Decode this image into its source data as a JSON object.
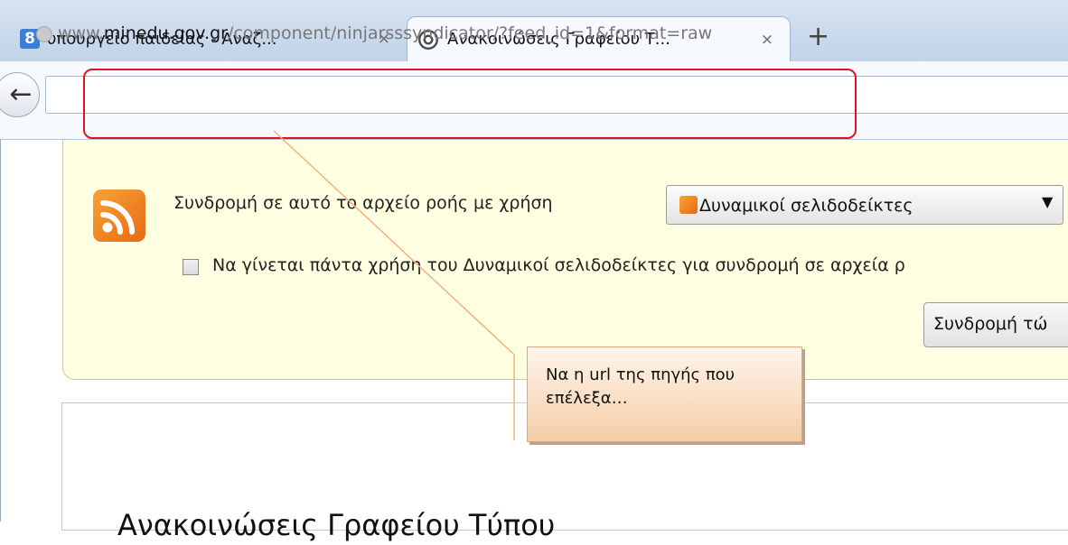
{
  "tabs": [
    {
      "label": "υπουργείο παιδείας - Αναζ...",
      "favicon": "google-icon",
      "favicon_text": "8",
      "close": "×"
    },
    {
      "label": "Ανακοινώσεις Γραφείου Τ...",
      "favicon": "globe-icon",
      "close": "×",
      "active": true
    }
  ],
  "new_tab_label": "+",
  "nav": {
    "back_label": "←",
    "url": {
      "prefix": "www.",
      "domain": "minedu.gov.gr",
      "path": "/component/ninjarsssyndicator/?feed_id=1&format=raw"
    }
  },
  "feed": {
    "subscribe_label": "Συνδρομή σε αυτό το αρχείο ροής με χρήση",
    "reader_selected": "Δυναμικοί σελιδοδείκτες",
    "select_arrow": "▼",
    "always_use_label": "Να γίνεται πάντα χρήση του Δυναμικοί σελιδοδείκτες για συνδρομή σε αρχεία ρ",
    "always_use_checked": false,
    "subscribe_now_label": "Συνδρομή τώ"
  },
  "page": {
    "heading": "Ανακοινώσεις Γραφείου Τύπου"
  },
  "callout": {
    "line1": "Να η url  της πηγής που",
    "line2": "επέλεξα…"
  },
  "colors": {
    "highlight": "#e0141e",
    "feed_background": "#ffffe1",
    "callout_fill": "#f5cda6",
    "callout_line": "#f2b27a"
  }
}
